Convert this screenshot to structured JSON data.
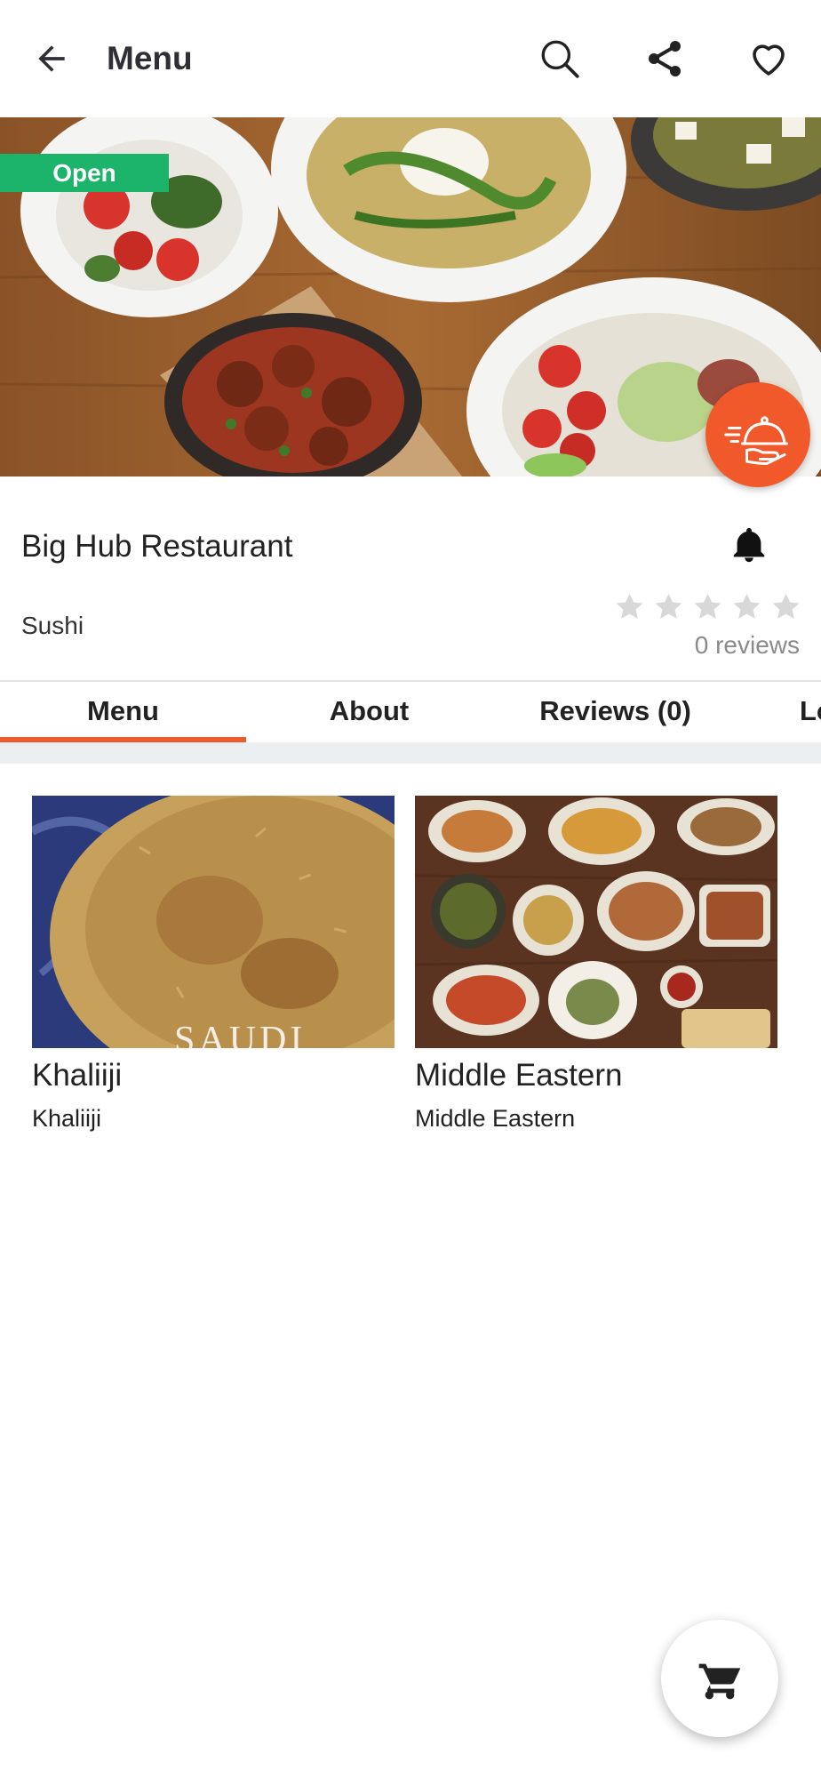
{
  "header": {
    "title": "Menu",
    "back_icon": "arrow-left-icon",
    "search_icon": "search-icon",
    "share_icon": "share-icon",
    "favorite_icon": "heart-icon"
  },
  "hero": {
    "status_badge": "Open",
    "delivery_icon": "delivery-cloche-icon",
    "colors": {
      "badge": "#1cb36b",
      "accent": "#f1592a"
    }
  },
  "restaurant": {
    "name": "Big Hub Restaurant",
    "cuisine": "Sushi",
    "rating": 0,
    "max_rating": 5,
    "reviews_label": "0 reviews",
    "notify_icon": "bell-icon"
  },
  "tabs": [
    {
      "label": "Menu",
      "active": true
    },
    {
      "label": "About",
      "active": false
    },
    {
      "label": "Reviews (0)",
      "active": false
    },
    {
      "label": "Lo",
      "active": false
    }
  ],
  "categories": [
    {
      "title": "Khaliiji",
      "subtitle": "Khaliiji",
      "image_text": "SAUDI"
    },
    {
      "title": "Middle Eastern",
      "subtitle": "Middle Eastern"
    }
  ],
  "cart": {
    "icon": "cart-icon"
  }
}
